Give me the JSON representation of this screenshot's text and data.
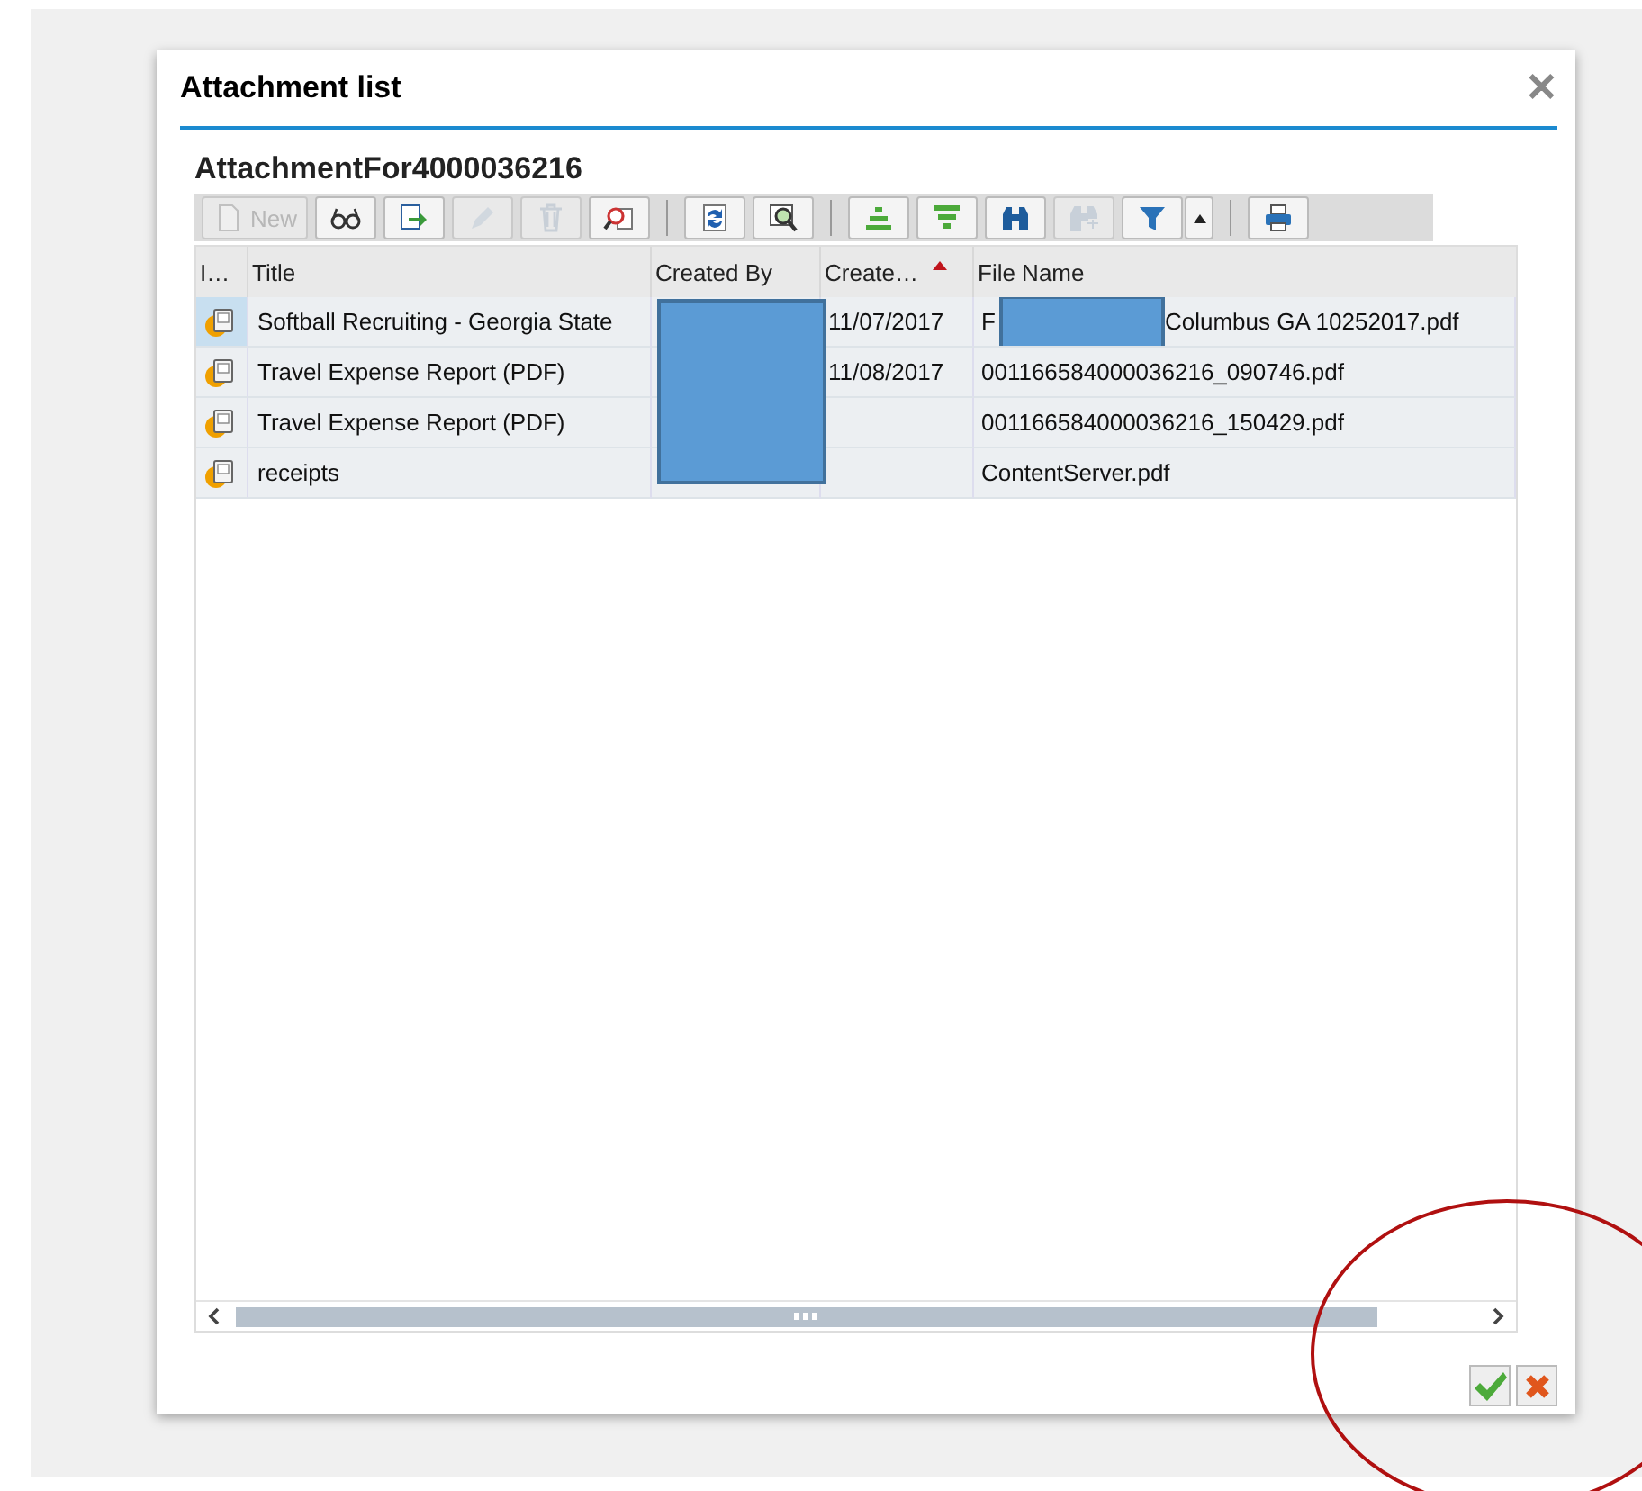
{
  "dialog": {
    "title": "Attachment list",
    "close": "✕"
  },
  "subtitle": "AttachmentFor4000036216",
  "toolbar": [
    {
      "kind": "new",
      "label": "New",
      "disabled": true
    },
    {
      "kind": "glasses",
      "disabled": false
    },
    {
      "kind": "export",
      "disabled": false
    },
    {
      "kind": "pencil",
      "disabled": true
    },
    {
      "kind": "trash",
      "disabled": true
    },
    {
      "kind": "inspect",
      "disabled": false
    },
    {
      "kind": "separator"
    },
    {
      "kind": "refresh",
      "disabled": false
    },
    {
      "kind": "zoom",
      "disabled": false
    },
    {
      "kind": "separator"
    },
    {
      "kind": "align",
      "disabled": false
    },
    {
      "kind": "filter",
      "disabled": false
    },
    {
      "kind": "binoculars",
      "disabled": false
    },
    {
      "kind": "binoculars-plus",
      "disabled": true
    },
    {
      "kind": "funnel",
      "disabled": false,
      "dropdown": true
    },
    {
      "kind": "separator"
    },
    {
      "kind": "print",
      "disabled": false
    }
  ],
  "table": {
    "columns": [
      {
        "label": "I…",
        "sorted": false
      },
      {
        "label": "Title",
        "sorted": false
      },
      {
        "label": "Created By",
        "sorted": false
      },
      {
        "label": "Create…",
        "sorted": true
      },
      {
        "label": "File Name",
        "sorted": false
      }
    ],
    "created_by_redacted": true,
    "rows": [
      {
        "selected": true,
        "title": "Softball Recruiting - Georgia State",
        "created_on": "11/07/2017",
        "file_name": [
          "F",
          "Columbus GA 10252017.pdf"
        ]
      },
      {
        "selected": false,
        "title": "Travel Expense Report (PDF)",
        "created_on": "11/08/2017",
        "file_name": [
          "001166584000036216_090746.pdf"
        ]
      },
      {
        "selected": false,
        "title": "Travel Expense Report (PDF)",
        "created_on": "",
        "file_name": [
          "001166584000036216_150429.pdf"
        ]
      },
      {
        "selected": false,
        "title": "receipts",
        "created_on": "",
        "file_name": [
          "ContentServer.pdf"
        ]
      }
    ]
  },
  "annotation": {
    "kind": "circle"
  }
}
